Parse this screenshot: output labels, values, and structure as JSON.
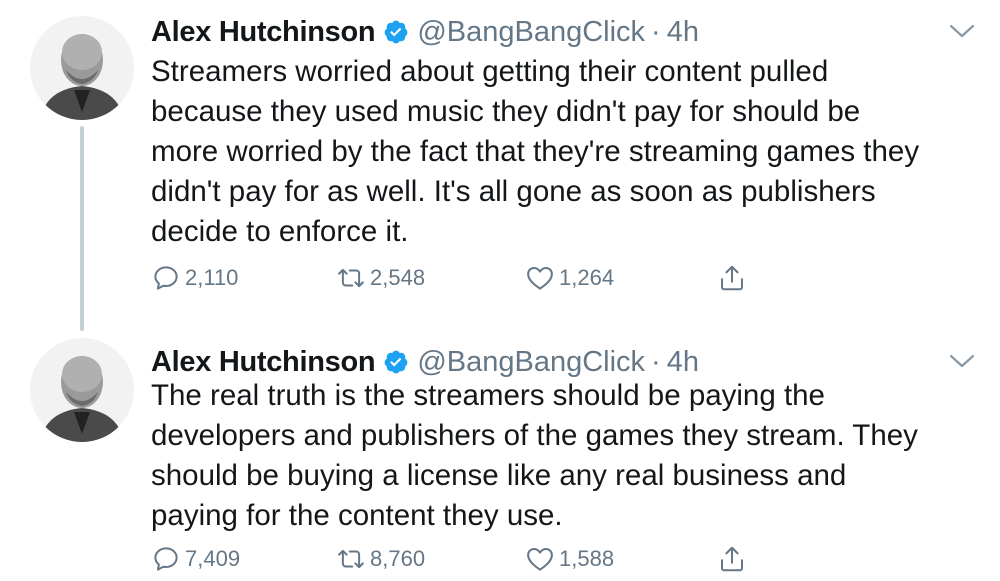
{
  "tweets": [
    {
      "author_name": "Alex Hutchinson",
      "handle": "@BangBangClick",
      "separator": "·",
      "time": "4h",
      "lines": [
        "Streamers worried about getting their content pulled",
        "because they used music they didn't pay for should be",
        "more worried by the fact that they're streaming games they",
        "didn't pay for as well. It's all gone as soon as publishers",
        "decide to enforce it."
      ],
      "replies": "2,110",
      "retweets": "2,548",
      "likes": "1,264"
    },
    {
      "author_name": "Alex Hutchinson",
      "handle": "@BangBangClick",
      "separator": "·",
      "time": "4h",
      "lines": [
        "The real truth is the streamers should be paying the",
        "developers and publishers of the games they stream. They",
        "should be buying a license like any real business and",
        "paying for the content they use."
      ],
      "replies": "7,409",
      "retweets": "8,760",
      "likes": "1,588"
    }
  ],
  "icons": {
    "verified": "verified-badge-icon",
    "caret": "chevron-down-icon",
    "reply": "reply-icon",
    "retweet": "retweet-icon",
    "like": "heart-icon",
    "share": "share-icon"
  },
  "colors": {
    "text": "#14171a",
    "secondary": "#657786",
    "verified": "#1da1f2",
    "thread_line": "#c4cfd6"
  }
}
